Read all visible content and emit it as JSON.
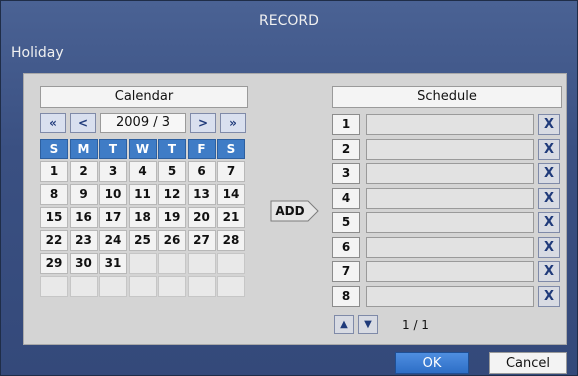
{
  "window": {
    "title": "RECORD",
    "subtitle": "Holiday"
  },
  "calendar": {
    "header": "Calendar",
    "nav": {
      "first": "«",
      "prev": "<",
      "next": ">",
      "last": "»"
    },
    "year_month": "2009 / 3",
    "weekdays": [
      "S",
      "M",
      "T",
      "W",
      "T",
      "F",
      "S"
    ],
    "weeks": [
      [
        "1",
        "2",
        "3",
        "4",
        "5",
        "6",
        "7"
      ],
      [
        "8",
        "9",
        "10",
        "11",
        "12",
        "13",
        "14"
      ],
      [
        "15",
        "16",
        "17",
        "18",
        "19",
        "20",
        "21"
      ],
      [
        "22",
        "23",
        "24",
        "25",
        "26",
        "27",
        "28"
      ],
      [
        "29",
        "30",
        "31",
        "",
        "",
        "",
        ""
      ],
      [
        "",
        "",
        "",
        "",
        "",
        "",
        ""
      ]
    ]
  },
  "add_button": {
    "label": "ADD"
  },
  "schedule": {
    "header": "Schedule",
    "rows": [
      {
        "num": "1",
        "value": ""
      },
      {
        "num": "2",
        "value": ""
      },
      {
        "num": "3",
        "value": ""
      },
      {
        "num": "4",
        "value": ""
      },
      {
        "num": "5",
        "value": ""
      },
      {
        "num": "6",
        "value": ""
      },
      {
        "num": "7",
        "value": ""
      },
      {
        "num": "8",
        "value": ""
      }
    ],
    "delete_label": "X",
    "up_label": "▲",
    "down_label": "▼",
    "page_indicator": "1 / 1"
  },
  "footer": {
    "ok_label": "OK",
    "cancel_label": "Cancel"
  },
  "colors": {
    "accent": "#3f7cc6",
    "background": "#3a5082"
  }
}
